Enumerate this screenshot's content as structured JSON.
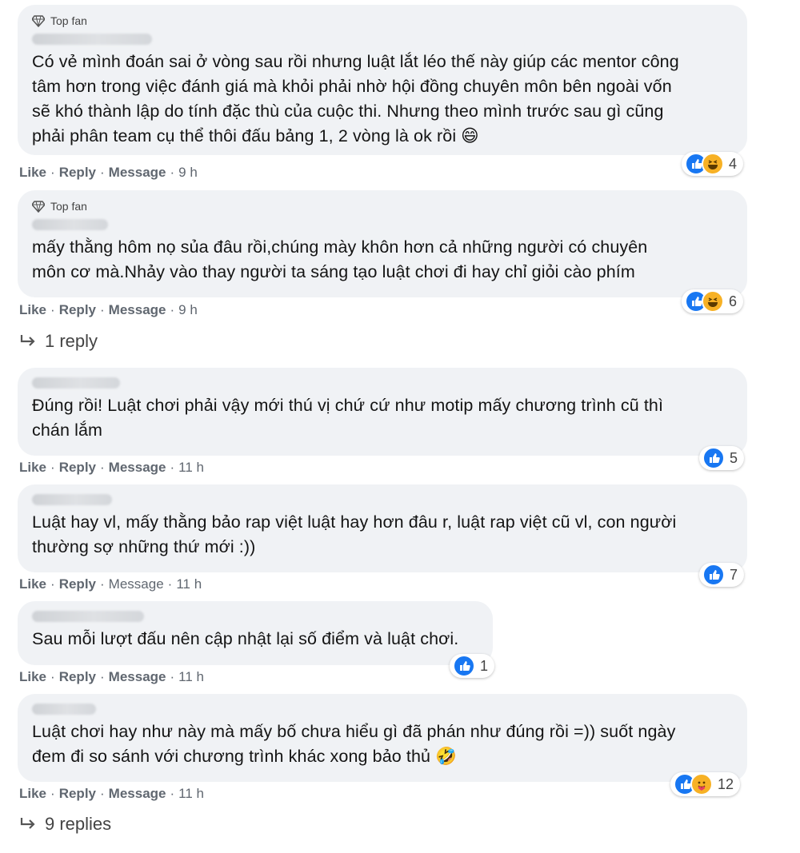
{
  "labels": {
    "top_fan": "Top fan",
    "like": "Like",
    "reply": "Reply",
    "message": "Message",
    "dot": "·"
  },
  "comments": [
    {
      "top_fan": true,
      "text": "Có vẻ mình đoán sai ở vòng sau rồi nhưng luật lắt léo thế này giúp các mentor công\ntâm hơn trong việc đánh giá mà khỏi phải nhờ hội đồng chuyên môn bên ngoài vốn\nsẽ khó thành lập do tính đặc thù của cuộc thi. Nhưng theo mình trước sau gì cũng\nphải phân team cụ thể thôi đấu bảng 1, 2 vòng là ok rồi 😄",
      "time": "9 h",
      "reaction_count": "4",
      "reactions": [
        "like",
        "haha"
      ]
    },
    {
      "top_fan": true,
      "text": "mấy thằng hôm nọ sủa đâu rồi,chúng mày khôn hơn cả những người có chuyên\nmôn cơ mà.Nhảy vào thay người ta sáng tạo luật chơi đi hay chỉ giỏi cào phím",
      "time": "9 h",
      "reaction_count": "6",
      "reactions": [
        "like",
        "haha"
      ],
      "replies_label": "1 reply"
    },
    {
      "top_fan": false,
      "text": "Đúng rồi! Luật chơi phải vậy mới thú vị chứ cứ như motip mấy chương trình cũ thì\nchán lắm",
      "time": "11 h",
      "reaction_count": "5",
      "reactions": [
        "like"
      ]
    },
    {
      "top_fan": false,
      "text": "Luật hay vl, mấy thằng bảo rap việt luật hay hơn đâu r, luật rap việt cũ vl, con người\nthường sợ những thứ mới :))",
      "time": "11 h",
      "reaction_count": "7",
      "reactions": [
        "like"
      ]
    },
    {
      "top_fan": false,
      "text": "Sau mỗi lượt đấu nên cập nhật lại số điểm và luật chơi.",
      "time": "11 h",
      "reaction_count": "1",
      "reactions": [
        "like"
      ]
    },
    {
      "top_fan": false,
      "text": "Luật chơi hay như này mà mấy bố chưa hiểu gì đã phán như đúng rồi =)) suốt ngày\nđem đi so sánh với chương trình khác xong bảo thủ 🤣",
      "time": "11 h",
      "reaction_count": "12",
      "reactions": [
        "like",
        "care"
      ],
      "replies_label": "9 replies"
    }
  ],
  "colors": {
    "bubble": "#f0f2f5",
    "like_blue": "#1877f2",
    "haha_yellow": "#f7b125",
    "meta_gray": "#606770"
  }
}
